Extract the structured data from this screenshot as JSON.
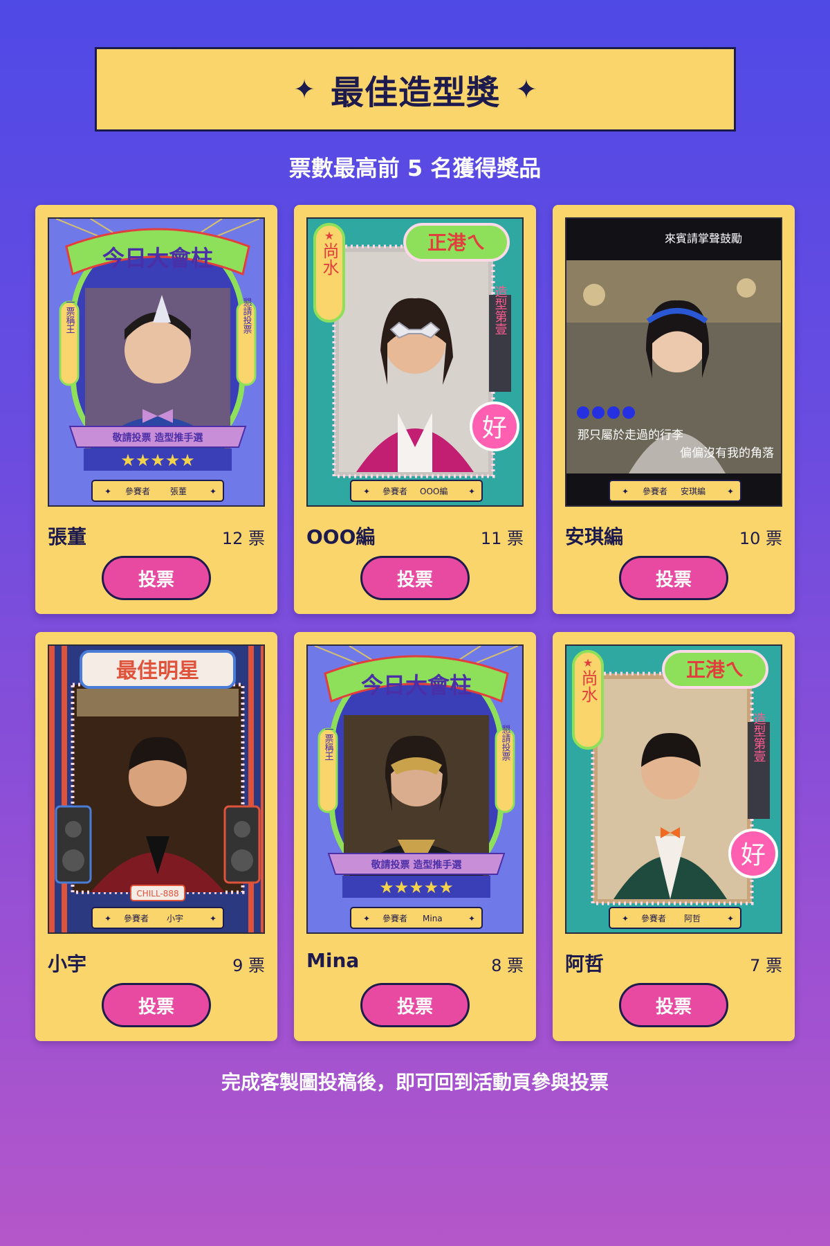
{
  "header": {
    "title": "最佳造型獎",
    "star_icon": "✦",
    "subtitle": "票數最高前 5 名獲得獎品"
  },
  "frame_text": {
    "marquee_title": "今日大會柱",
    "star_title": "最佳明星",
    "sign_left": "一票稱王",
    "sign_right": "懇請投票",
    "ribbon": "敬請投票 造型推手選",
    "hk_badge": "正港ㄟ",
    "hk_left": "尚水",
    "hk_right": "造型第壹",
    "hk_good": "好",
    "contestant_label": "參賽者",
    "plate_text": "CHILL-888",
    "caption_top": "來賓請掌聲鼓勵",
    "caption_line1": "那只屬於走過的行李",
    "caption_line2": "偏偏沒有我的角落"
  },
  "contestants": [
    {
      "name": "張董",
      "plate_name": "張董",
      "votes": "12 票",
      "frame": "marquee",
      "accent": "#6f79e8"
    },
    {
      "name": "OOO編",
      "plate_name": "OOO編",
      "votes": "11 票",
      "frame": "hk",
      "accent": "#2ea8a0"
    },
    {
      "name": "安琪編",
      "plate_name": "安琪編",
      "votes": "10 票",
      "frame": "subtitle",
      "accent": "#1a1a1a"
    },
    {
      "name": "小宇",
      "plate_name": "小宇",
      "votes": "9 票",
      "frame": "star",
      "accent": "#e0533b"
    },
    {
      "name": "Mina",
      "plate_name": "Mina",
      "votes": "8 票",
      "frame": "marquee",
      "accent": "#6f79e8"
    },
    {
      "name": "阿哲",
      "plate_name": "阿哲",
      "votes": "7 票",
      "frame": "hk",
      "accent": "#2ea8a0"
    }
  ],
  "vote_label": "投票",
  "footer_note": "完成客製圖投稿後，即可回到活動頁參與投票",
  "colors": {
    "background_top": "#4f49e6",
    "background_bottom": "#b457c9",
    "card": "#fad56b",
    "vote_button": "#e84aa1",
    "text_dark": "#1d1a4d"
  }
}
